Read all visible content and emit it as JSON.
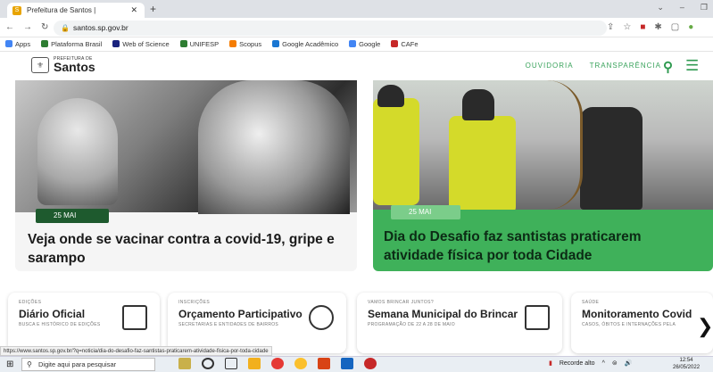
{
  "browser": {
    "tab_title": "Prefeitura de Santos |",
    "url": "santos.sp.gov.br",
    "bookmarks": [
      {
        "label": "Apps",
        "color": "#4285f4"
      },
      {
        "label": "Plataforma Brasil",
        "color": "#2e7d32"
      },
      {
        "label": "Web of Science",
        "color": "#1a237e"
      },
      {
        "label": "UNIFESP",
        "color": "#2e7d32"
      },
      {
        "label": "Scopus",
        "color": "#f57c00"
      },
      {
        "label": "Google Acadêmico",
        "color": "#1976d2"
      },
      {
        "label": "Google",
        "color": "#4285f4"
      },
      {
        "label": "CAFe",
        "color": "#c62828"
      }
    ],
    "status_url": "https://www.santos.sp.gov.br/?q=noticia/dia-do-desafio-faz-santistas-praticarem-atividade-fisica-por-toda-cidade"
  },
  "site": {
    "logo_small": "PREFEITURA DE",
    "logo_big": "Santos",
    "nav": [
      "OUVIDORIA",
      "TRANSPARÊNCIA"
    ],
    "accent": "#3aa35c"
  },
  "news": [
    {
      "date": "25 MAI",
      "title": "Veja onde se vacinar contra a covid-19, gripe e sarampo"
    },
    {
      "date": "25 MAI",
      "title": "Dia do Desafio faz santistas praticarem atividade física por toda Cidade"
    }
  ],
  "quick_links": [
    {
      "kicker": "EDIÇÕES",
      "title": "Diário Oficial",
      "subtitle": "BUSCA E HISTÓRICO DE EDIÇÕES",
      "icon": "newspaper-icon"
    },
    {
      "kicker": "INSCRIÇÕES",
      "title": "Orçamento Participativo",
      "subtitle": "SECRETARIAS E ENTIDADES DE BAIRROS",
      "icon": "participation-icon"
    },
    {
      "kicker": "VAMOS BRINCAR JUNTOS?",
      "title": "Semana Municipal do Brincar",
      "subtitle": "PROGRAMAÇÃO DE 22 A 28 DE MAIO",
      "icon": "house-icon"
    },
    {
      "kicker": "SAÚDE",
      "title": "Monitoramento Covid",
      "subtitle": "CASOS, ÓBITOS E INTERNAÇÕES PELA",
      "icon": "chart-icon"
    }
  ],
  "taskbar": {
    "search_placeholder": "Digite aqui para pesquisar",
    "weather": "Recorde alto",
    "time": "12:54",
    "date": "26/05/2022"
  }
}
